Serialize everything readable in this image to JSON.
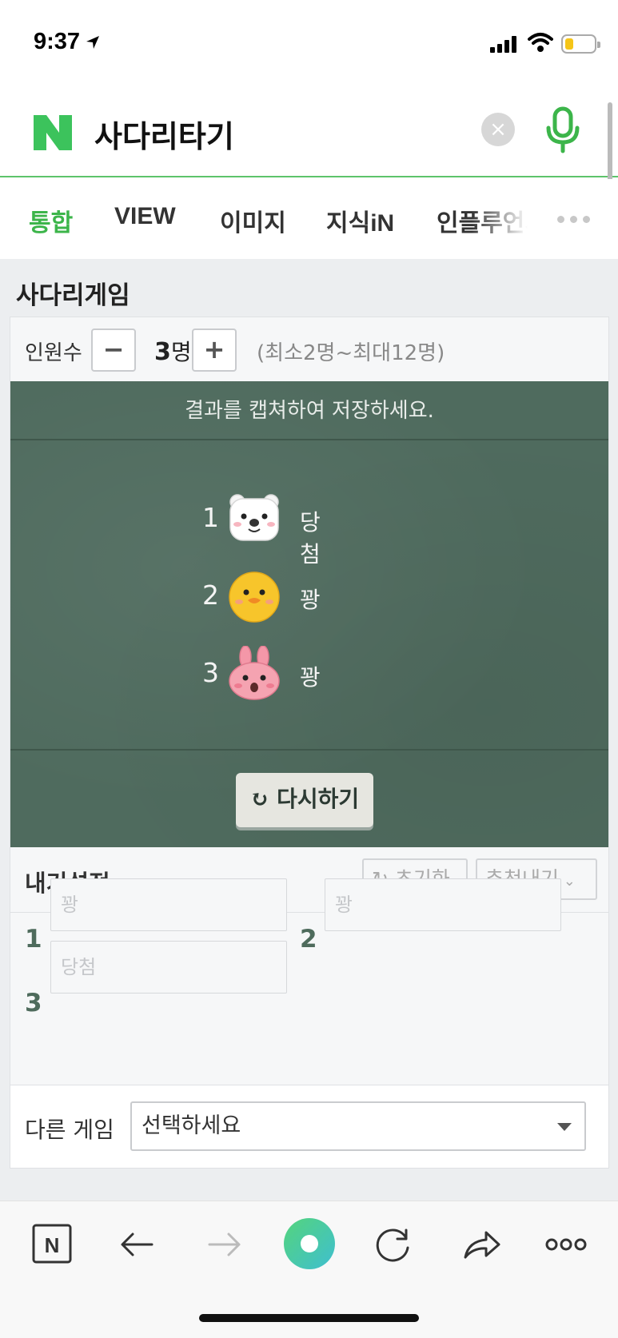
{
  "status": {
    "time": "9:37"
  },
  "search": {
    "query": "사다리타기",
    "clear_label": "×"
  },
  "tabs": [
    "통합",
    "VIEW",
    "이미지",
    "지식iN",
    "인플루언서"
  ],
  "game": {
    "title": "사다리게임",
    "people_label": "인원수",
    "minus": "−",
    "plus": "+",
    "count": "3",
    "count_unit": "명",
    "range": "(최소2명~최대12명)",
    "board_notice": "결과를 캡쳐하여 저장하세요.",
    "results": [
      {
        "num": "1",
        "character": "polar-bear",
        "result": "당첨"
      },
      {
        "num": "2",
        "character": "chick",
        "result": "꽝"
      },
      {
        "num": "3",
        "character": "rabbit",
        "result": "꽝"
      }
    ],
    "retry_label": "다시하기"
  },
  "settings": {
    "title": "내기설정",
    "reset_label": "초기화",
    "recommend_label": "추천내기",
    "slots": [
      {
        "num": "1",
        "value": "꽝"
      },
      {
        "num": "2",
        "value": "꽝"
      },
      {
        "num": "3",
        "value": "당첨"
      }
    ]
  },
  "other_game": {
    "label": "다른 게임",
    "selected": "선택하세요"
  },
  "colors": {
    "brand_green": "#3cb54a",
    "board": "#4f6b5e",
    "accent": "#4e6b5c"
  }
}
